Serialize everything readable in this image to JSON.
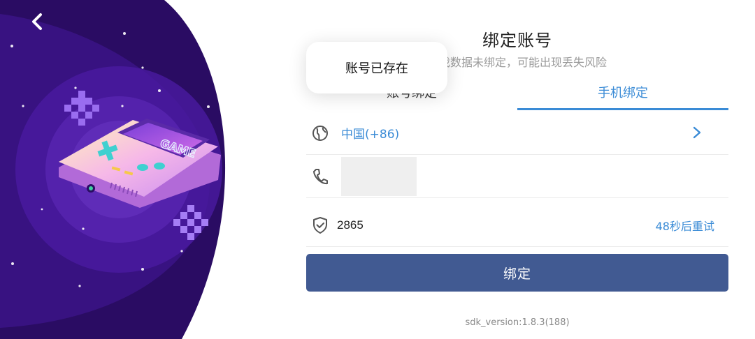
{
  "header": {
    "title": "绑定账号",
    "subtitle": "游戏数据未绑定，可能出现丢失风险"
  },
  "tabs": [
    {
      "label": "账号绑定",
      "active": false
    },
    {
      "label": "手机绑定",
      "active": true
    }
  ],
  "form": {
    "region": "中国(+86)",
    "phone_value": "",
    "code_value": "2865",
    "resend_label": "48秒后重试"
  },
  "bind_button": {
    "label": "绑定"
  },
  "version": "sdk_version:1.8.3(188)",
  "toast": {
    "message": "账号已存在"
  },
  "art": {
    "device_label": "GAME"
  },
  "colors": {
    "accent": "#3a8bd6",
    "button": "#415a92",
    "panel_dark": "#2a0c63",
    "panel_mid": "#4a1aa0"
  },
  "icons": {
    "back": "back-arrow-icon",
    "region": "globe-icon",
    "phone": "phone-icon",
    "code": "shield-check-icon",
    "chevron": "chevron-right-icon"
  }
}
